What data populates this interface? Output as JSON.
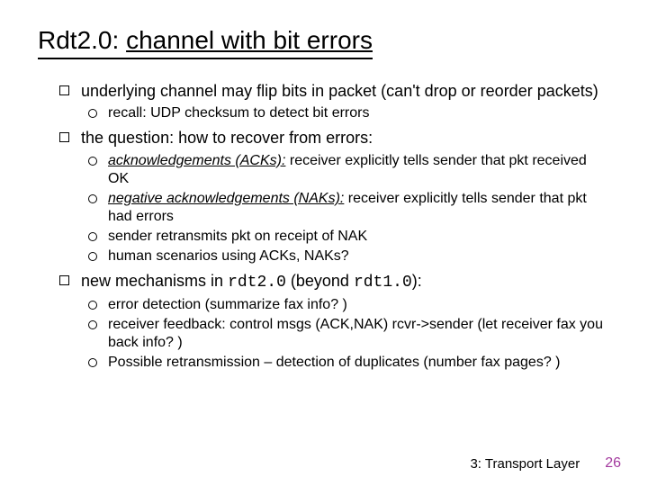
{
  "title_prefix": "Rdt2.0: ",
  "title_underlined": "channel with bit errors",
  "bullets": [
    {
      "text": "underlying channel may flip bits in packet (can't drop or reorder packets)",
      "sub": [
        {
          "text": "recall: UDP checksum to detect bit errors"
        }
      ]
    },
    {
      "text": "the question: how to recover from errors:",
      "sub": [
        {
          "em": "acknowledgements (ACKs):",
          "rest": " receiver explicitly tells sender that pkt received OK"
        },
        {
          "em": "negative acknowledgements (NAKs):",
          "rest": " receiver explicitly tells sender that pkt had errors"
        },
        {
          "text": "sender retransmits pkt on receipt of NAK"
        },
        {
          "text": "human scenarios using ACKs, NAKs?"
        }
      ]
    },
    {
      "pre": "new mechanisms in ",
      "mono1": "rdt2.0",
      "mid": " (beyond ",
      "mono2": "rdt1.0",
      "post": "):",
      "sub": [
        {
          "text": "error detection (summarize fax info? )"
        },
        {
          "text": "receiver feedback: control msgs (ACK,NAK) rcvr->sender (let receiver fax you back info? )"
        },
        {
          "text": "Possible retransmission – detection of duplicates (number fax pages? )"
        }
      ]
    }
  ],
  "footer": {
    "section": "3: Transport Layer",
    "page": "26"
  }
}
